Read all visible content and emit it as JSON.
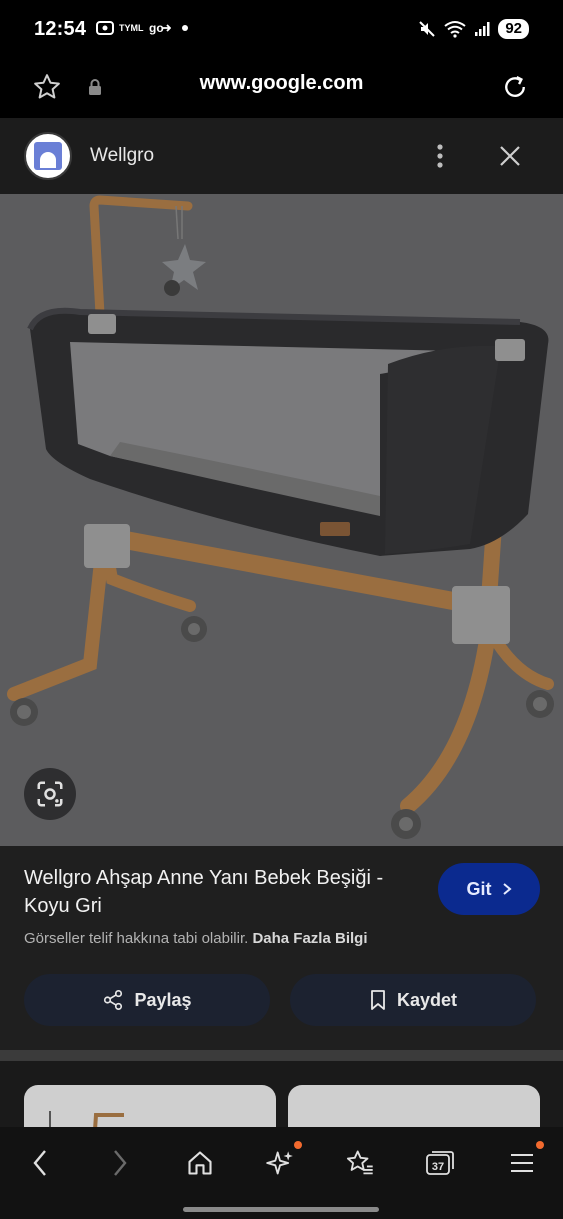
{
  "status_bar": {
    "time": "12:54",
    "carrier_badge": "TYML",
    "battery": "92"
  },
  "browser": {
    "url": "www.google.com"
  },
  "site": {
    "name": "Wellgro"
  },
  "product": {
    "title": "Wellgro Ahşap Anne Yanı Bebek Beşiği - Koyu Gri",
    "visit_label": "Git",
    "copyright_text": "Görseller telif hakkına tabi olabilir.",
    "more_info_link": "Daha Fazla Bilgi"
  },
  "actions": {
    "share_label": "Paylaş",
    "save_label": "Kaydet"
  },
  "bottom_nav": {
    "tabs_count": "37"
  },
  "colors": {
    "visit_button_bg": "#0b2a8f",
    "action_button_bg": "#1c2230",
    "notification_dot": "#f26a2e"
  },
  "icons": [
    "star-icon",
    "lock-icon",
    "reload-icon",
    "more-vert-icon",
    "close-icon",
    "lens-icon",
    "chevron-right-icon",
    "share-icon",
    "bookmark-icon",
    "back-icon",
    "forward-icon",
    "home-icon",
    "sparkle-icon",
    "favorites-icon",
    "tabs-icon",
    "menu-icon"
  ]
}
